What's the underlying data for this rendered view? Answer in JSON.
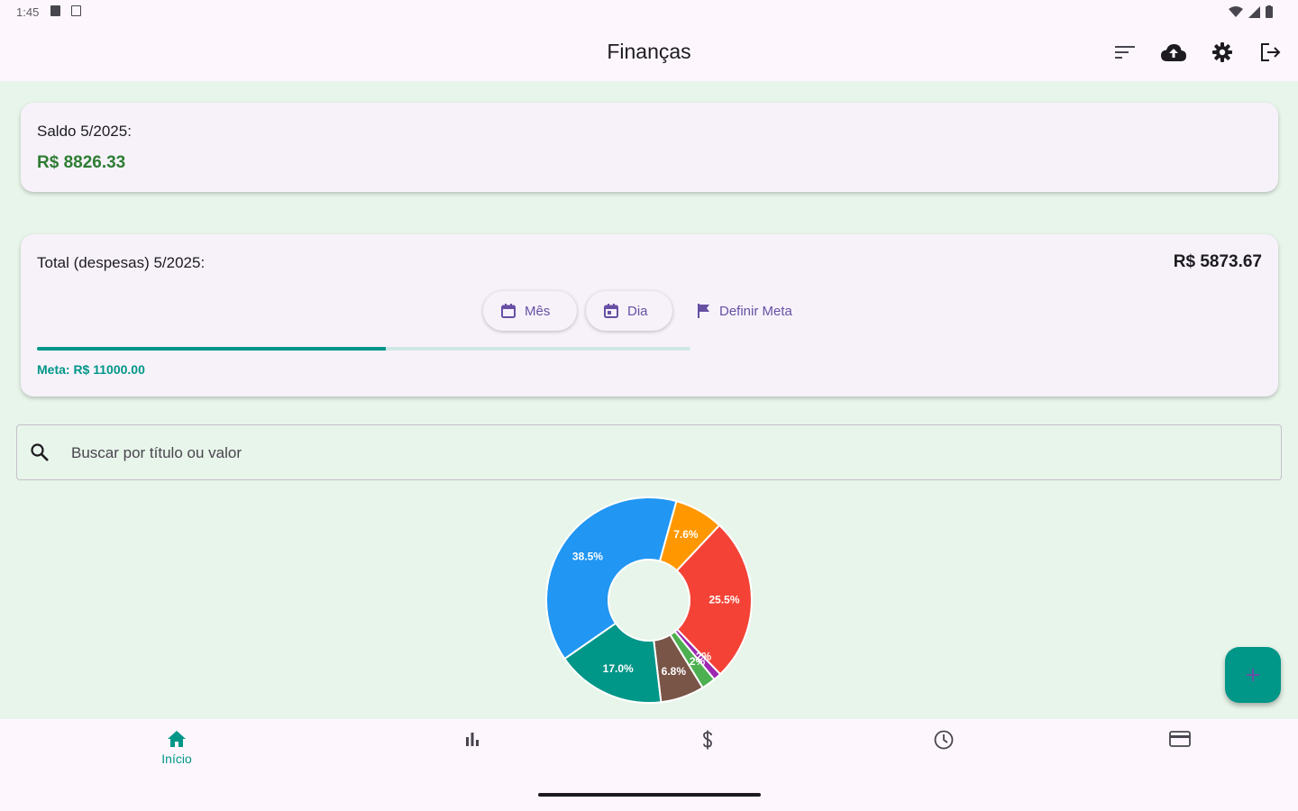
{
  "status_bar": {
    "time": "1:45",
    "left_icons": [
      "sim-card-icon",
      "screenshot-icon"
    ],
    "right_icons": [
      "wifi-icon",
      "signal-icon",
      "battery-icon"
    ]
  },
  "app_bar": {
    "title": "Finanças",
    "actions": [
      "sort-icon",
      "cloud-upload-icon",
      "settings-icon",
      "logout-icon"
    ]
  },
  "balance_card": {
    "label": "Saldo 5/2025:",
    "value": "R$ 8826.33",
    "value_color": "#2e7d32"
  },
  "expenses_card": {
    "label": "Total (despesas) 5/2025:",
    "value": "R$ 5873.67",
    "chips": {
      "month": "Mês",
      "day": "Dia"
    },
    "set_goal_label": "Definir Meta",
    "goal_label": "Meta: R$ 11000.00",
    "goal_progress": 0.534
  },
  "search": {
    "placeholder": "Buscar por título ou valor",
    "value": ""
  },
  "chart_data": {
    "type": "pie",
    "donut": true,
    "slices": [
      {
        "label": "25.5%",
        "value": 25.5,
        "color": "#f44336"
      },
      {
        "label": "1.2%",
        "value": 1.2,
        "color": "#9c27b0"
      },
      {
        "label": "2.2%",
        "value": 2.2,
        "color": "#4caf50"
      },
      {
        "label": "6.8%",
        "value": 6.8,
        "color": "#795548"
      },
      {
        "label": "17.0%",
        "value": 17.0,
        "color": "#009688"
      },
      {
        "label": "38.5%",
        "value": 38.5,
        "color": "#2196f3"
      },
      {
        "label": "7.6%",
        "value": 7.6,
        "color": "#ff9800"
      }
    ]
  },
  "fab": {
    "icon": "plus-icon"
  },
  "bottom_nav": {
    "items": [
      {
        "label": "Início",
        "icon": "home-icon",
        "active": true
      },
      {
        "label": "",
        "icon": "bar-chart-icon",
        "active": false
      },
      {
        "label": "",
        "icon": "dollar-icon",
        "active": false
      },
      {
        "label": "",
        "icon": "clock-icon",
        "active": false
      },
      {
        "label": "",
        "icon": "credit-card-icon",
        "active": false
      }
    ]
  },
  "colors": {
    "accent": "#009688",
    "primary": "#6750a4",
    "background": "#e8f5ea"
  }
}
